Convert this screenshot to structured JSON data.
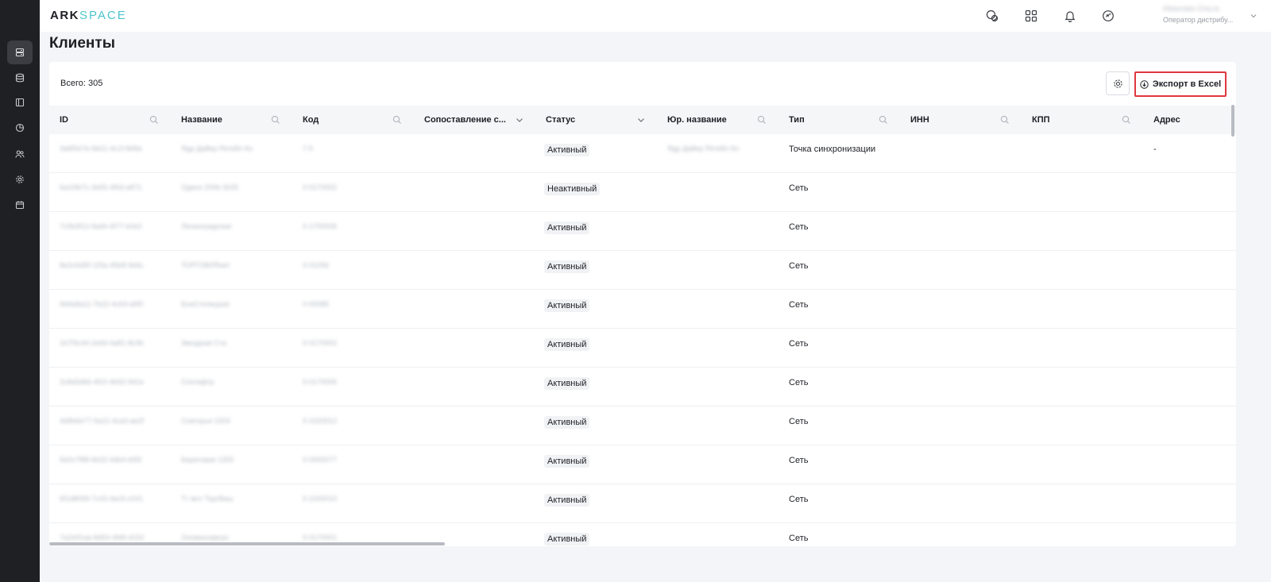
{
  "app": {
    "logo_main": "ARK",
    "logo_accent": "SPACE"
  },
  "rail": {
    "items": [
      {
        "icon": "list-icon",
        "active": true
      },
      {
        "icon": "database-icon",
        "active": false
      },
      {
        "icon": "sidebar-panel-icon",
        "active": false
      },
      {
        "icon": "pie-chart-icon",
        "active": false
      },
      {
        "icon": "users-icon",
        "active": false
      },
      {
        "icon": "gear-icon",
        "active": false
      },
      {
        "icon": "calendar-icon",
        "active": false
      }
    ]
  },
  "header": {
    "icons": [
      "chat-icon",
      "grid-icon",
      "bell-icon",
      "sync-icon"
    ],
    "user_name": "Ивановa Ольга",
    "user_role": "Оператор дистрибу..."
  },
  "page": {
    "title": "Клиенты"
  },
  "toolbar": {
    "total_label": "Всего: 305",
    "export_label": "Экспорт в Excel"
  },
  "table": {
    "columns": [
      {
        "label": "ID",
        "icon": "search-icon"
      },
      {
        "label": "Название",
        "icon": "search-icon"
      },
      {
        "label": "Код",
        "icon": "search-icon"
      },
      {
        "label": "Сопоставление с...",
        "icon": "chevron-down-icon"
      },
      {
        "label": "Статус",
        "icon": "chevron-down-icon"
      },
      {
        "label": "Юр. название",
        "icon": "search-icon"
      },
      {
        "label": "Тип",
        "icon": "search-icon"
      },
      {
        "label": "ИНН",
        "icon": "search-icon"
      },
      {
        "label": "КПП",
        "icon": "search-icon"
      },
      {
        "label": "Адрес",
        "icon": ""
      }
    ],
    "rows": [
      {
        "id": "3a6f0e7e-6b21-4c1f-8d9a",
        "name": "Ядр Дайер Ретейл Ко",
        "code": "7-5",
        "status": "Активный",
        "legal": "Ядр Дайер Ретейл Ко",
        "type": "Точка синхронизации",
        "address": "-"
      },
      {
        "id": "6a1f4b7c-3e55-4f0d-a871",
        "name": "Одиси 2006-3025",
        "code": "0-0170002",
        "status": "Неактивный",
        "legal": "",
        "type": "Сеть",
        "address": ""
      },
      {
        "id": "7c0b3f12-9ad4-4f77-b0e2",
        "name": "Ленинградская",
        "code": "0-1700006",
        "status": "Активный",
        "legal": "",
        "type": "Сеть",
        "address": ""
      },
      {
        "id": "8e2c6d90-1f3a-45b8-9e6c",
        "name": "ТОРГОВЛЯнет",
        "code": "0-01056",
        "status": "Активный",
        "legal": "",
        "type": "Сеть",
        "address": ""
      },
      {
        "id": "9d4e8a11-7b22-4c63-a5f0",
        "name": "БоиСтолицкая",
        "code": "0-00085",
        "status": "Активный",
        "legal": "",
        "type": "Сеть",
        "address": ""
      },
      {
        "id": "1b7f3c44-2e9d-4a81-8c0b",
        "name": "Звездная Сти",
        "code": "0-0170002",
        "status": "Активный",
        "legal": "",
        "type": "Сеть",
        "address": ""
      },
      {
        "id": "2c8a5d66-4f10-4b92-9d1e",
        "name": "Спотафтр",
        "code": "0-0170006",
        "status": "Активный",
        "legal": "",
        "type": "Сеть",
        "address": ""
      },
      {
        "id": "4d9b6e77-5a21-4ca3-ae2f",
        "name": "Снегорья 1003",
        "code": "0-1020012",
        "status": "Активный",
        "legal": "",
        "type": "Сеть",
        "address": ""
      },
      {
        "id": "5e0c7f88-6b32-4db4-bf30",
        "name": "Береговая 1305",
        "code": "0-0000077",
        "status": "Активный",
        "legal": "",
        "type": "Сеть",
        "address": ""
      },
      {
        "id": "6f1d8099-7c43-4ec5-c041",
        "name": "Тт мгл ТоргВиш",
        "code": "0-1000010",
        "status": "Активный",
        "legal": "",
        "type": "Сеть",
        "address": ""
      },
      {
        "id": "7a2e91aa-8d54-4fd6-d152",
        "name": "Оновиннавгро",
        "code": "0-0170001",
        "status": "Активный",
        "legal": "",
        "type": "Сеть",
        "address": ""
      }
    ]
  }
}
